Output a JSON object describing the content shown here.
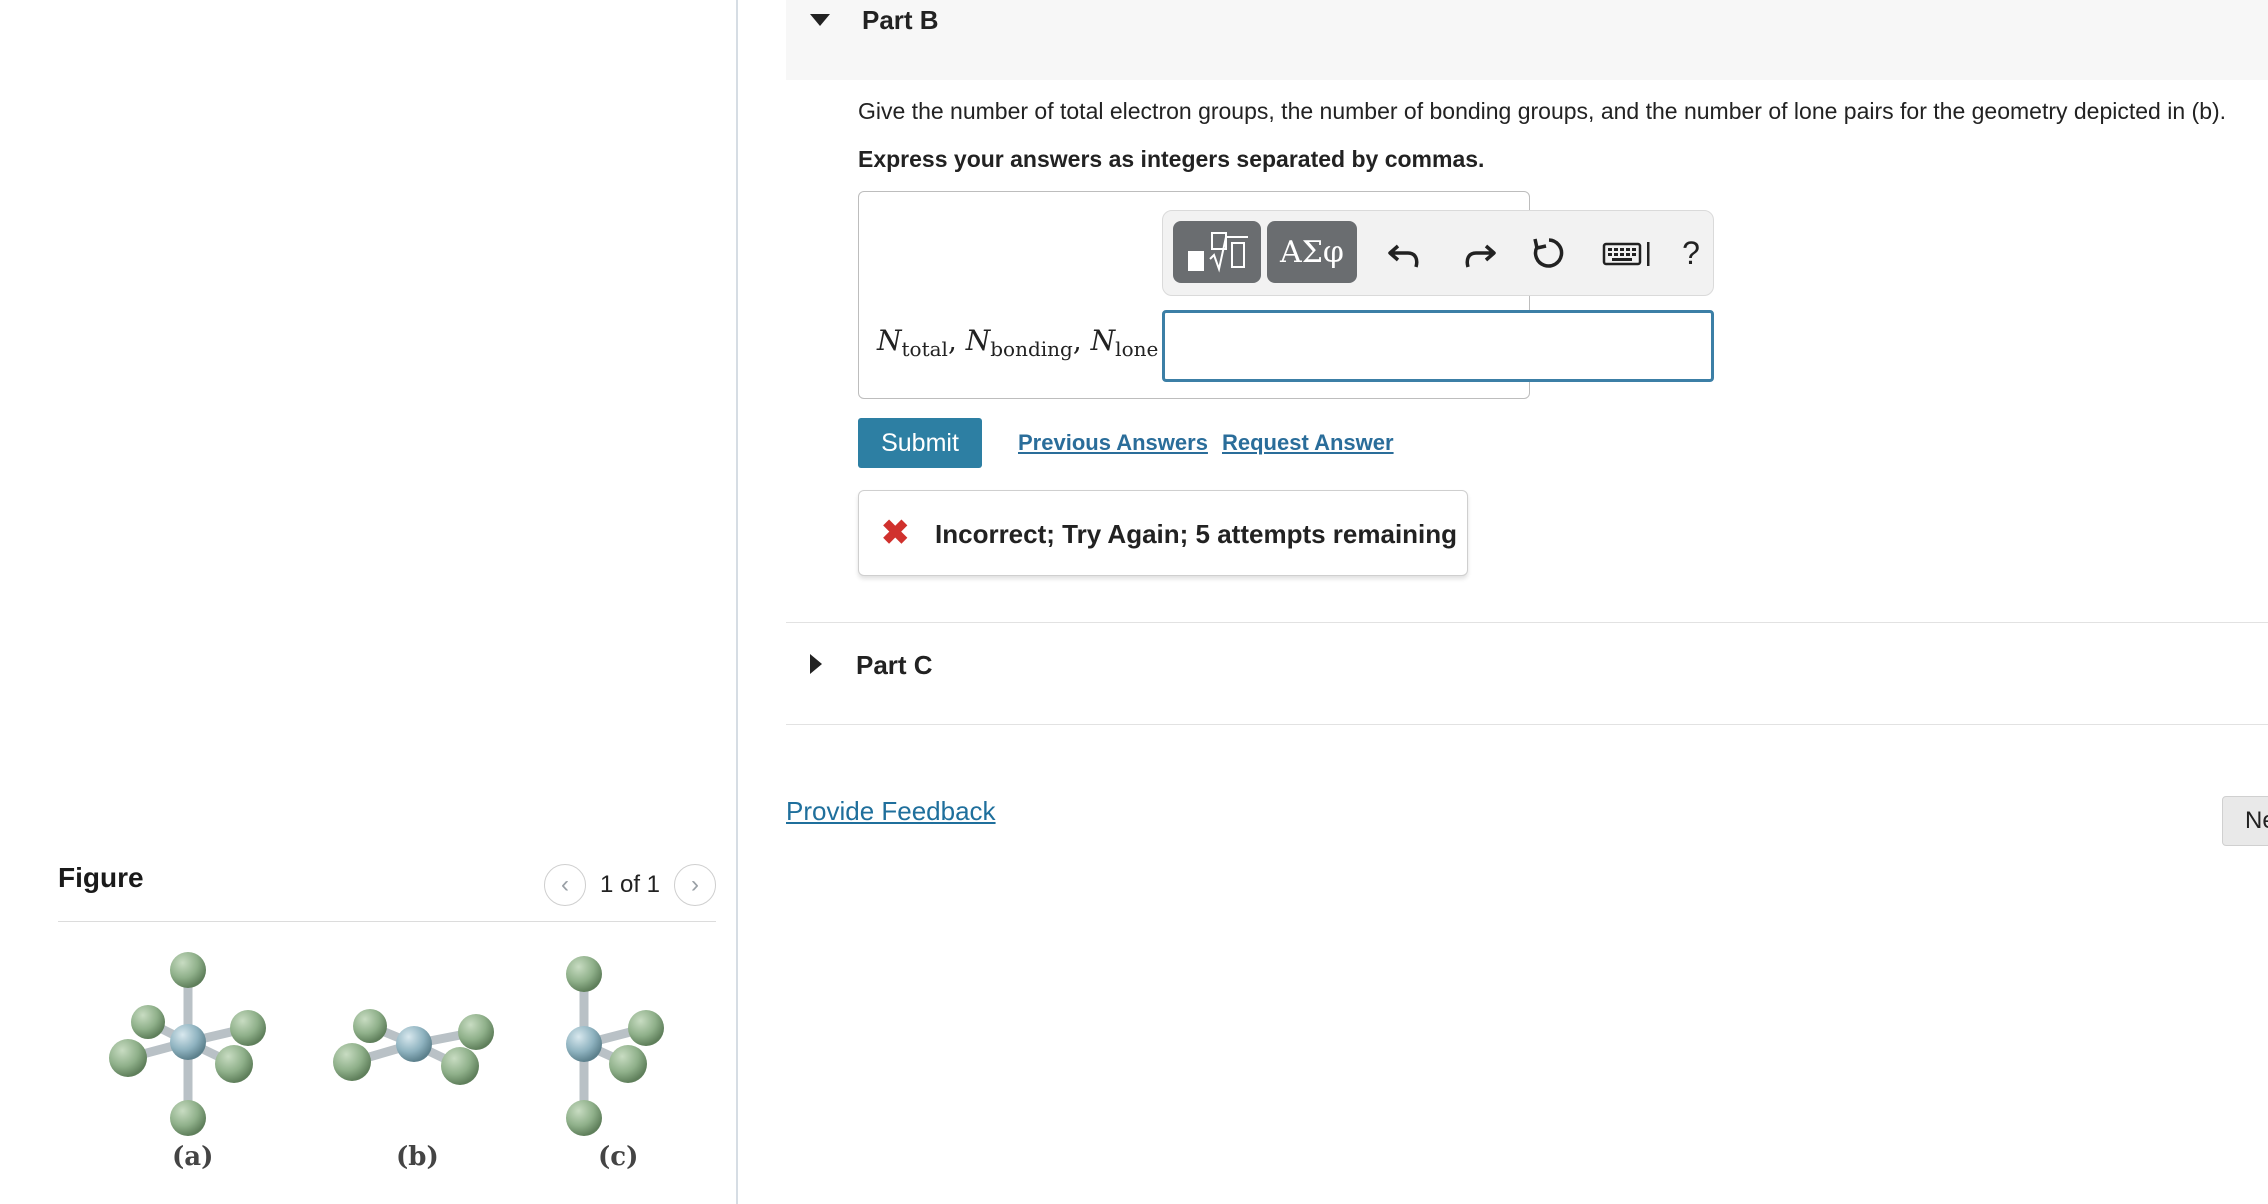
{
  "figure": {
    "title": "Figure",
    "pager_text": "1 of 1",
    "prev_icon": "chevron-left-icon",
    "next_icon": "chevron-right-icon",
    "labels": [
      "(a)",
      "(b)",
      "(c)"
    ],
    "colors": {
      "central_atom": "#8fb3c0",
      "outer_atom": "#8fb08a",
      "bond": "#b9c1c6"
    }
  },
  "part_b": {
    "title": "Part B",
    "question": "Give the number of total electron groups, the number of bonding groups, and the number of lone pairs for the geometry depicted in (b).",
    "instruction": "Express your answers as integers separated by commas.",
    "toolbar": {
      "templates_icon": "sqrt-template-icon",
      "symbols_label": "ΑΣφ",
      "undo_icon": "undo-icon",
      "redo_icon": "redo-icon",
      "reset_icon": "reset-icon",
      "keyboard_icon": "keyboard-icon",
      "help_label": "?"
    },
    "equation": {
      "n1": "N",
      "s1": "total",
      "n2": "N",
      "s2": "bonding",
      "n3": "N",
      "s3": "lone",
      "sep": ", ",
      "equals": " ="
    },
    "answer_value": "",
    "submit_label": "Submit",
    "previous_answers_label": "Previous Answers",
    "request_answer_label": "Request Answer",
    "feedback": "Incorrect; Try Again; 5 attempts remaining",
    "accent_color": "#2d7fa3",
    "error_color": "#d0312d"
  },
  "part_c": {
    "title": "Part C"
  },
  "footer": {
    "provide_feedback_label": "Provide Feedback",
    "next_label": "Next"
  }
}
